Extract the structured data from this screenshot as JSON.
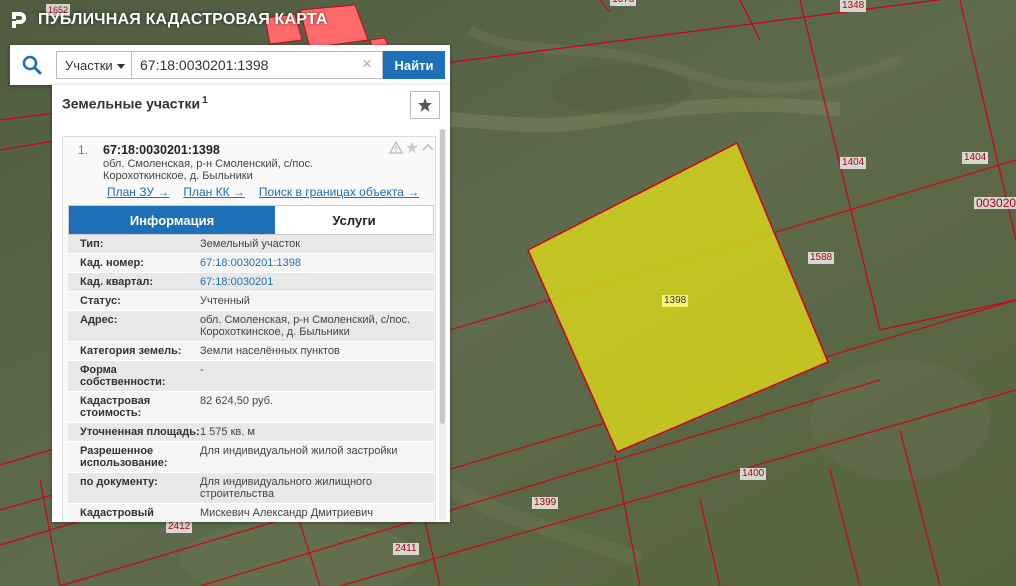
{
  "header": {
    "title": "ПУБЛИЧНАЯ КАДАСТРОВАЯ КАРТА"
  },
  "search": {
    "type_label": "Участки",
    "query": "67:18:0030201:1398",
    "button_label": "Найти"
  },
  "panel": {
    "title": "Земельные участки",
    "count": "1",
    "result": {
      "number": "1.",
      "title": "67:18:0030201:1398",
      "address": "обл. Смоленская, р-н Смоленский, с/пос. Корохоткинское, д. Быльники",
      "links": [
        "План ЗУ →",
        "План КК →",
        "Поиск в границах объекта →"
      ]
    },
    "tabs": {
      "info": "Информация",
      "services": "Услуги"
    },
    "info_rows": [
      {
        "label": "Тип:",
        "value": "Земельный участок",
        "link": false
      },
      {
        "label": "Кад. номер:",
        "value": "67:18:0030201:1398",
        "link": true
      },
      {
        "label": "Кад. квартал:",
        "value": "67:18:0030201",
        "link": true
      },
      {
        "label": "Статус:",
        "value": "Учтенный",
        "link": false
      },
      {
        "label": "Адрес:",
        "value": "обл. Смоленская, р-н Смоленский, с/пос. Корохоткинское, д. Быльники",
        "link": false
      },
      {
        "label": "Категория земель:",
        "value": "Земли населённых пунктов",
        "link": false
      },
      {
        "label": "Форма собственности:",
        "value": "-",
        "link": false
      },
      {
        "label": "Кадастровая стоимость:",
        "value": "82 624,50 руб.",
        "link": false
      },
      {
        "label": "Уточненная площадь:",
        "value": "1 575 кв. м",
        "link": false
      },
      {
        "label": "Разрешенное использование:",
        "value": "Для индивидуальной жилой застройки",
        "link": false
      },
      {
        "label": "по документу:",
        "value": "Для индивидуального жилищного строительства",
        "link": false
      },
      {
        "label": "Кадастровый",
        "value": "Мискевич Александр Дмитриевич",
        "link": false
      }
    ]
  },
  "map": {
    "selected_parcel_label": "1398",
    "parcel_labels": [
      "1348",
      "1404",
      "1404",
      "003020",
      "1588",
      "1400",
      "1399",
      "2412",
      "2411",
      "1652",
      "1676"
    ],
    "colors": {
      "parcel_border": "#d0021b",
      "selected_fill": "#d4d41c",
      "highlight_fill": "#ff6b6b",
      "accent": "#1d6fb8"
    }
  }
}
